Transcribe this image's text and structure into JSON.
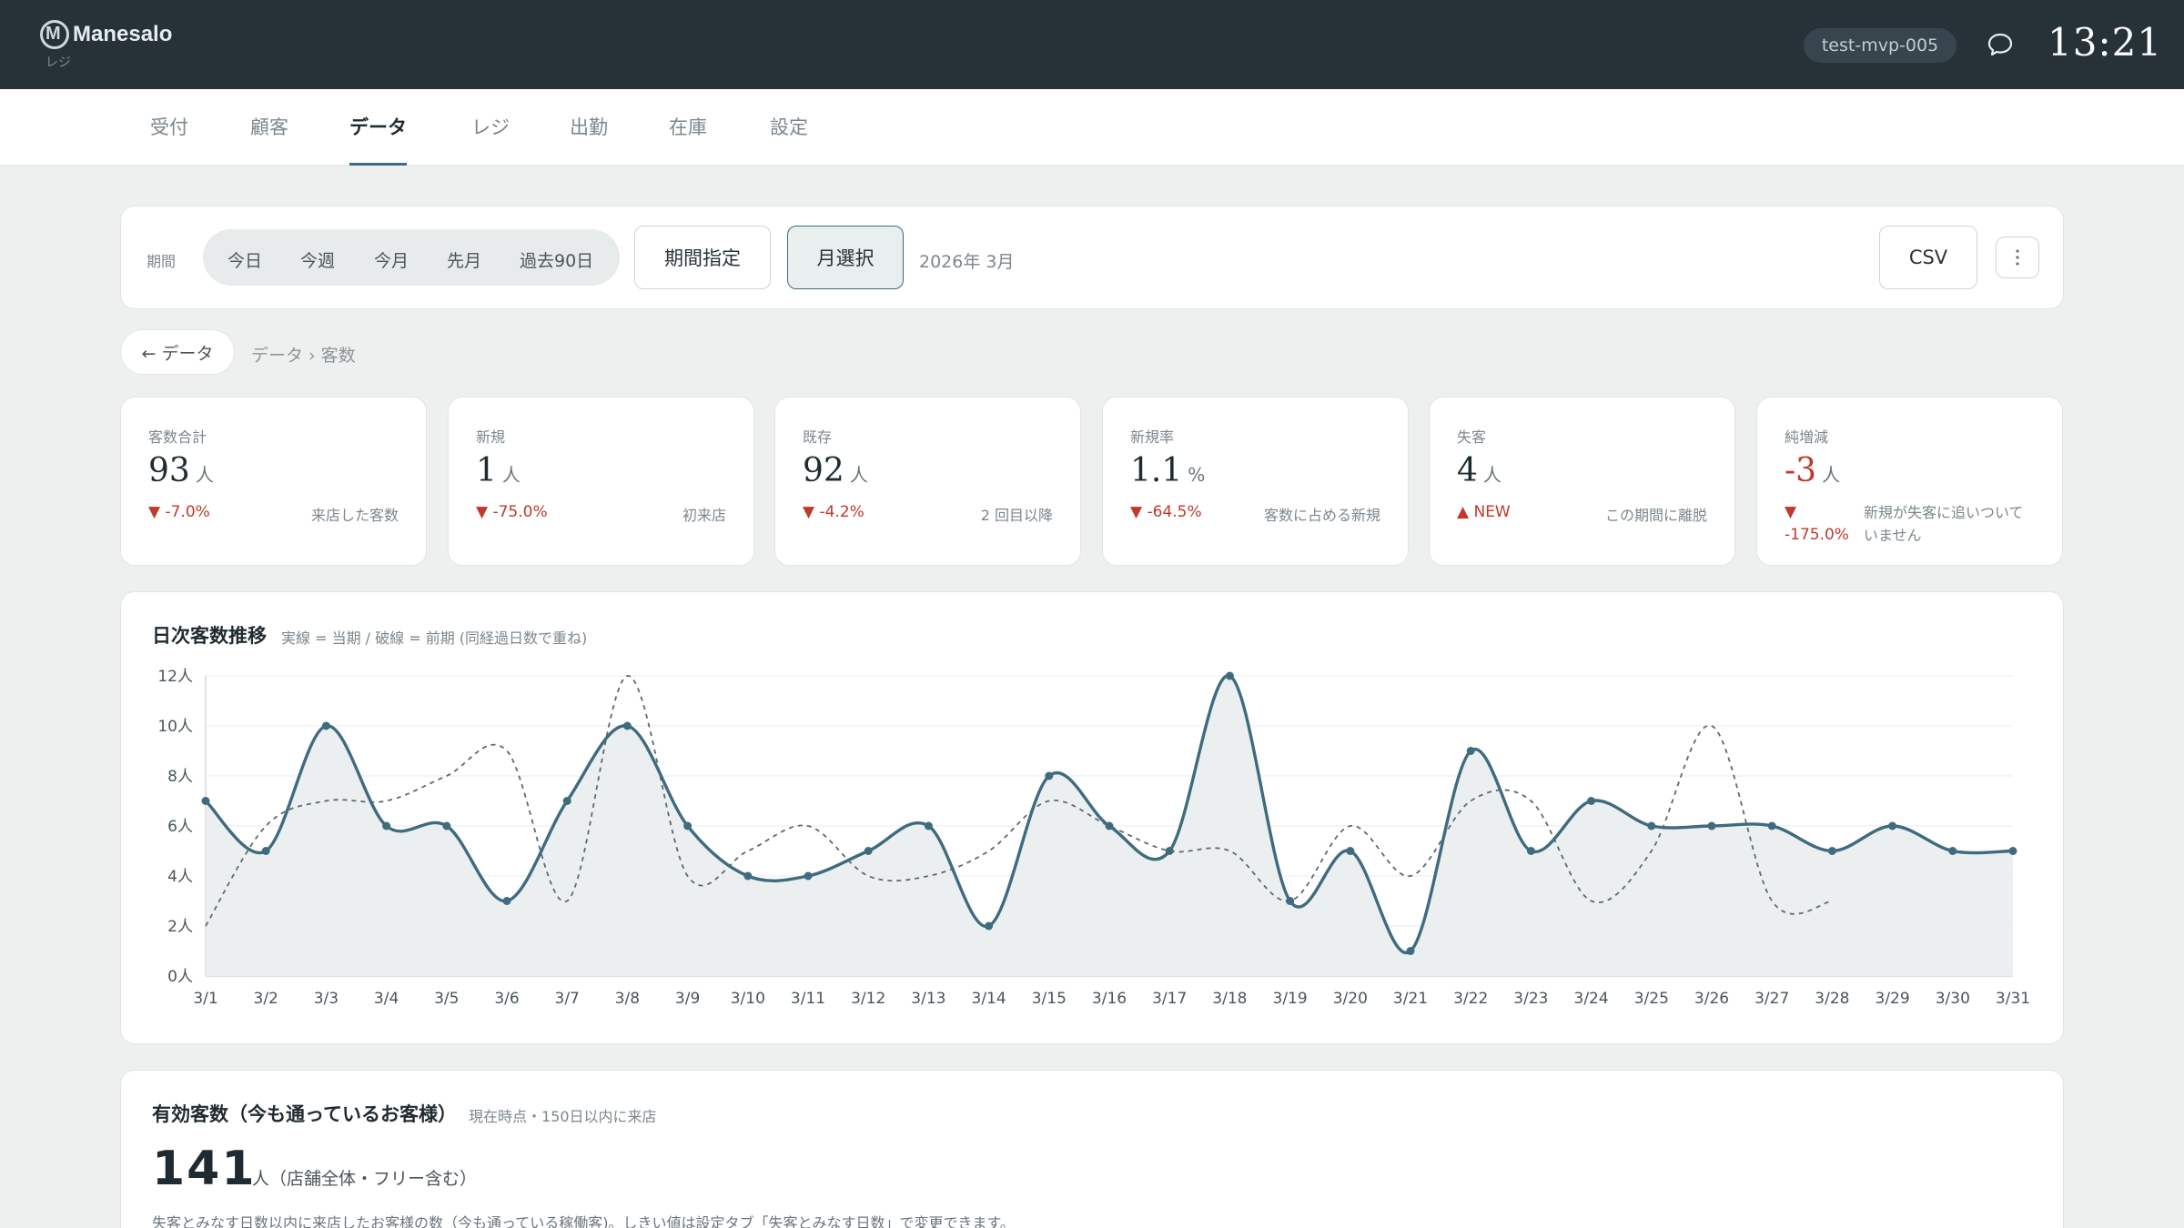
{
  "app": {
    "name": "Manesalo",
    "sub": "レジ",
    "tenant": "test-mvp-005",
    "time": "13:21"
  },
  "nav": {
    "items": [
      "受付",
      "顧客",
      "データ",
      "レジ",
      "出勤",
      "在庫",
      "設定"
    ],
    "active": "データ"
  },
  "filter": {
    "period_label": "期間",
    "presets": [
      "今日",
      "今週",
      "今月",
      "先月",
      "過去90日"
    ],
    "range_button": "期間指定",
    "month_button": "月選択",
    "selected_month": "2026年 3月",
    "csv_button": "CSV",
    "more_icon": "kebab-icon"
  },
  "breadcrumb": {
    "back": "← データ",
    "path": "データ › 客数"
  },
  "kpis": [
    {
      "title": "客数合計",
      "value": "93",
      "unit": "人",
      "delta": "▼ -7.0%",
      "note": "来店した客数",
      "negative": false
    },
    {
      "title": "新規",
      "value": "1",
      "unit": "人",
      "delta": "▼ -75.0%",
      "note": "初来店",
      "negative": false
    },
    {
      "title": "既存",
      "value": "92",
      "unit": "人",
      "delta": "▼ -4.2%",
      "note": "2 回目以降",
      "negative": false
    },
    {
      "title": "新規率",
      "value": "1.1",
      "unit": "%",
      "delta": "▼ -64.5%",
      "note": "客数に占める新規",
      "negative": false
    },
    {
      "title": "失客",
      "value": "4",
      "unit": "人",
      "delta": "▲ NEW",
      "note": "この期間に離脱",
      "negative": false
    },
    {
      "title": "純増減",
      "value": "-3",
      "unit": "人",
      "delta": "▼ -175.0%",
      "note": "新規が失客に追いついていません",
      "negative": true
    }
  ],
  "chart": {
    "title": "日次客数推移",
    "subtitle": "実線 = 当期 / 破線 = 前期 (同経過日数で重ね)"
  },
  "chart_data": {
    "type": "line",
    "categories": [
      "3/1",
      "3/2",
      "3/3",
      "3/4",
      "3/5",
      "3/6",
      "3/7",
      "3/8",
      "3/9",
      "3/10",
      "3/11",
      "3/12",
      "3/13",
      "3/14",
      "3/15",
      "3/16",
      "3/17",
      "3/18",
      "3/19",
      "3/20",
      "3/21",
      "3/22",
      "3/23",
      "3/24",
      "3/25",
      "3/26",
      "3/27",
      "3/28",
      "3/29",
      "3/30",
      "3/31"
    ],
    "series": [
      {
        "values": [
          7,
          5,
          10,
          6,
          6,
          3,
          7,
          10,
          6,
          4,
          4,
          5,
          6,
          2,
          8,
          6,
          5,
          12,
          3,
          5,
          1,
          9,
          5,
          7,
          6,
          6,
          6,
          5,
          6,
          5,
          5
        ]
      },
      {
        "values": [
          2,
          6,
          7,
          7,
          8,
          9,
          3,
          12,
          4,
          5,
          6,
          4,
          4,
          5,
          7,
          6,
          5,
          5,
          3,
          6,
          4,
          7,
          7,
          3,
          5,
          10,
          3,
          3
        ]
      }
    ],
    "y_ticks": [
      "0人",
      "2人",
      "4人",
      "6人",
      "8人",
      "10人",
      "12人"
    ],
    "ylim": [
      0,
      12
    ],
    "grid": true,
    "colors": {
      "current": "#3f6b7e",
      "previous": "#5d6a70",
      "area": "#e9edee"
    }
  },
  "active": {
    "title": "有効客数（今も通っているお客様）",
    "subtitle": "現在時点・150日以内に来店",
    "value": "141",
    "unit": "人（店舗全体・フリー含む）",
    "description": "失客とみなす日数以内に来店したお客様の数（今も通っている稼働客)。しきい値は設定タブ「失客とみなす日数」で変更できます。"
  }
}
